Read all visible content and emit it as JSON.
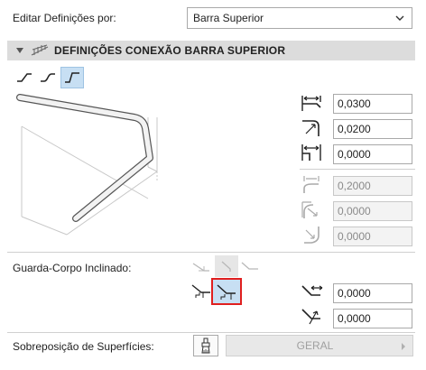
{
  "edit_row": {
    "label": "Editar Definições por:",
    "select_value": "Barra Superior",
    "select_icon": "chevron-down-icon"
  },
  "section": {
    "title": "DEFINIÇÕES CONEXÃO BARRA SUPERIOR",
    "collapse_icon": "triangle-down-icon",
    "section_icon": "railing-icon"
  },
  "connection_types": [
    {
      "name": "straight-connection-icon",
      "selected": false
    },
    {
      "name": "curved-connection-icon",
      "selected": false
    },
    {
      "name": "angled-connection-icon",
      "selected": true
    }
  ],
  "parameters": [
    {
      "icon": "horizontal-offset-icon",
      "value": "0,0300",
      "enabled": true
    },
    {
      "icon": "corner-radius-icon",
      "value": "0,0200",
      "enabled": true
    },
    {
      "icon": "horizontal-extension-icon",
      "value": "0,0000",
      "enabled": true
    },
    {
      "icon": "curve-length-icon",
      "value": "0,2000",
      "enabled": false
    },
    {
      "icon": "curve-radius-icon",
      "value": "0,0000",
      "enabled": false
    },
    {
      "icon": "inner-radius-icon",
      "value": "0,0000",
      "enabled": false
    }
  ],
  "inclined": {
    "label": "Guarda-Corpo Inclinado:",
    "values": [
      "0,0000",
      "0,0000"
    ]
  },
  "overlap": {
    "label": "Sobreposição de Superfícies:",
    "button": "GERAL"
  }
}
